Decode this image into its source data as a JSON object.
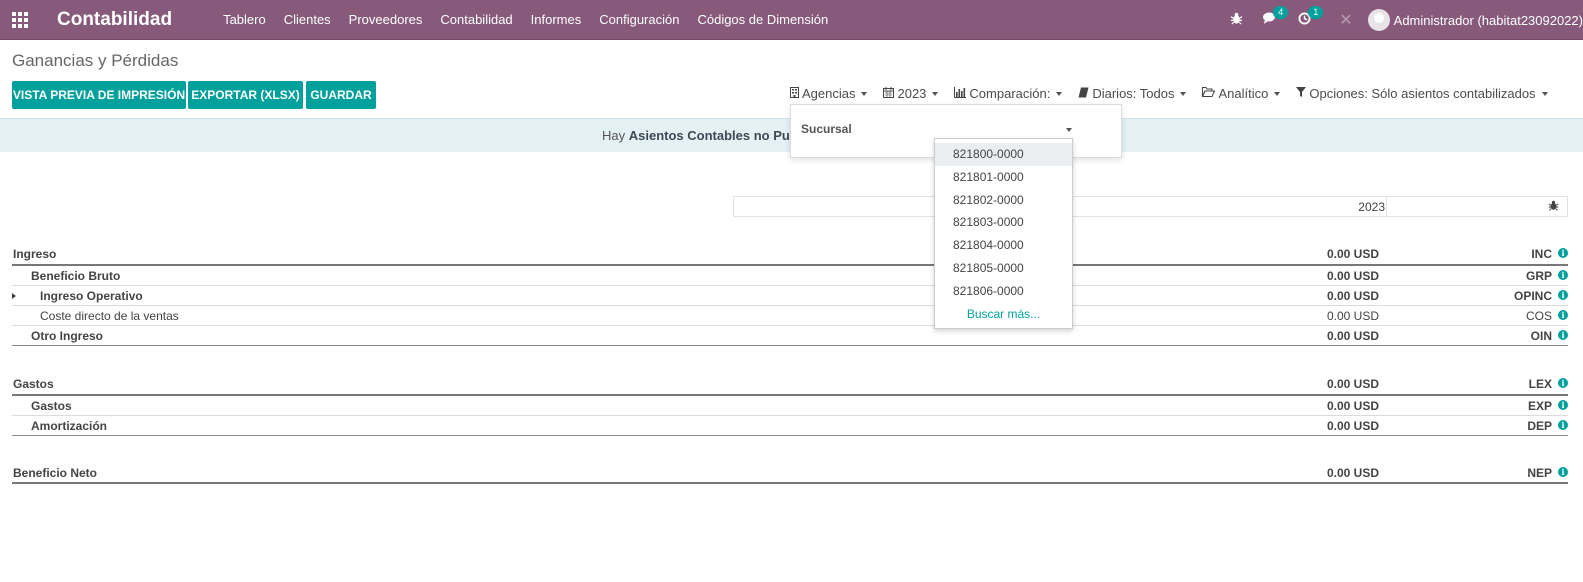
{
  "navbar": {
    "brand": "Contabilidad",
    "menu": [
      "Tablero",
      "Clientes",
      "Proveedores",
      "Contabilidad",
      "Informes",
      "Configuración",
      "Códigos de Dimensión"
    ],
    "messages_count": "4",
    "activities_count": "1",
    "user": "Administrador (habitat23092022)"
  },
  "page": {
    "breadcrumb": "Ganancias y Pérdidas",
    "buttons": {
      "print_preview": "VISTA PREVIA DE IMPRESIÓN",
      "export": "EXPORTAR (XLSX)",
      "save": "GUARDAR"
    },
    "filters": {
      "agencies": "Agencias",
      "year": "2023",
      "comparison": "Comparación:",
      "journals": "Diarios: Todos",
      "analytic": "Analítico",
      "options": "Opciones: Sólo asientos contabilizados"
    },
    "alert": {
      "prefix": "Hay ",
      "bold": "Asientos Contables no Publicad"
    }
  },
  "popover": {
    "label": "Sucursal"
  },
  "dropdown": {
    "items": [
      "821800-0000",
      "821801-0000",
      "821802-0000",
      "821803-0000",
      "821804-0000",
      "821805-0000",
      "821806-0000"
    ],
    "more": "Buscar más..."
  },
  "report": {
    "column": "2023",
    "rows": [
      {
        "name": "Ingreso",
        "amount": "0.00 USD",
        "code": "INC"
      },
      {
        "name": "Beneficio Bruto",
        "amount": "0.00 USD",
        "code": "GRP"
      },
      {
        "name": "Ingreso Operativo",
        "amount": "0.00 USD",
        "code": "OPINC"
      },
      {
        "name": "Coste directo de la ventas",
        "amount": "0.00 USD",
        "code": "COS"
      },
      {
        "name": "Otro Ingreso",
        "amount": "0.00 USD",
        "code": "OIN"
      },
      {
        "name": "Gastos",
        "amount": "0.00 USD",
        "code": "LEX"
      },
      {
        "name": "Gastos",
        "amount": "0.00 USD",
        "code": "EXP"
      },
      {
        "name": "Amortización",
        "amount": "0.00 USD",
        "code": "DEP"
      },
      {
        "name": "Beneficio Neto",
        "amount": "0.00 USD",
        "code": "NEP"
      }
    ]
  },
  "icons": {
    "apps": "apps-grid-icon",
    "debug": "bug-icon",
    "messages": "comments-icon",
    "activities": "clock-icon",
    "close": "close-icon",
    "info": "info-circle-icon"
  },
  "colors": {
    "navbar": "#875A7B",
    "primary": "#00a09d",
    "alert_bg": "#e3f0f4"
  }
}
